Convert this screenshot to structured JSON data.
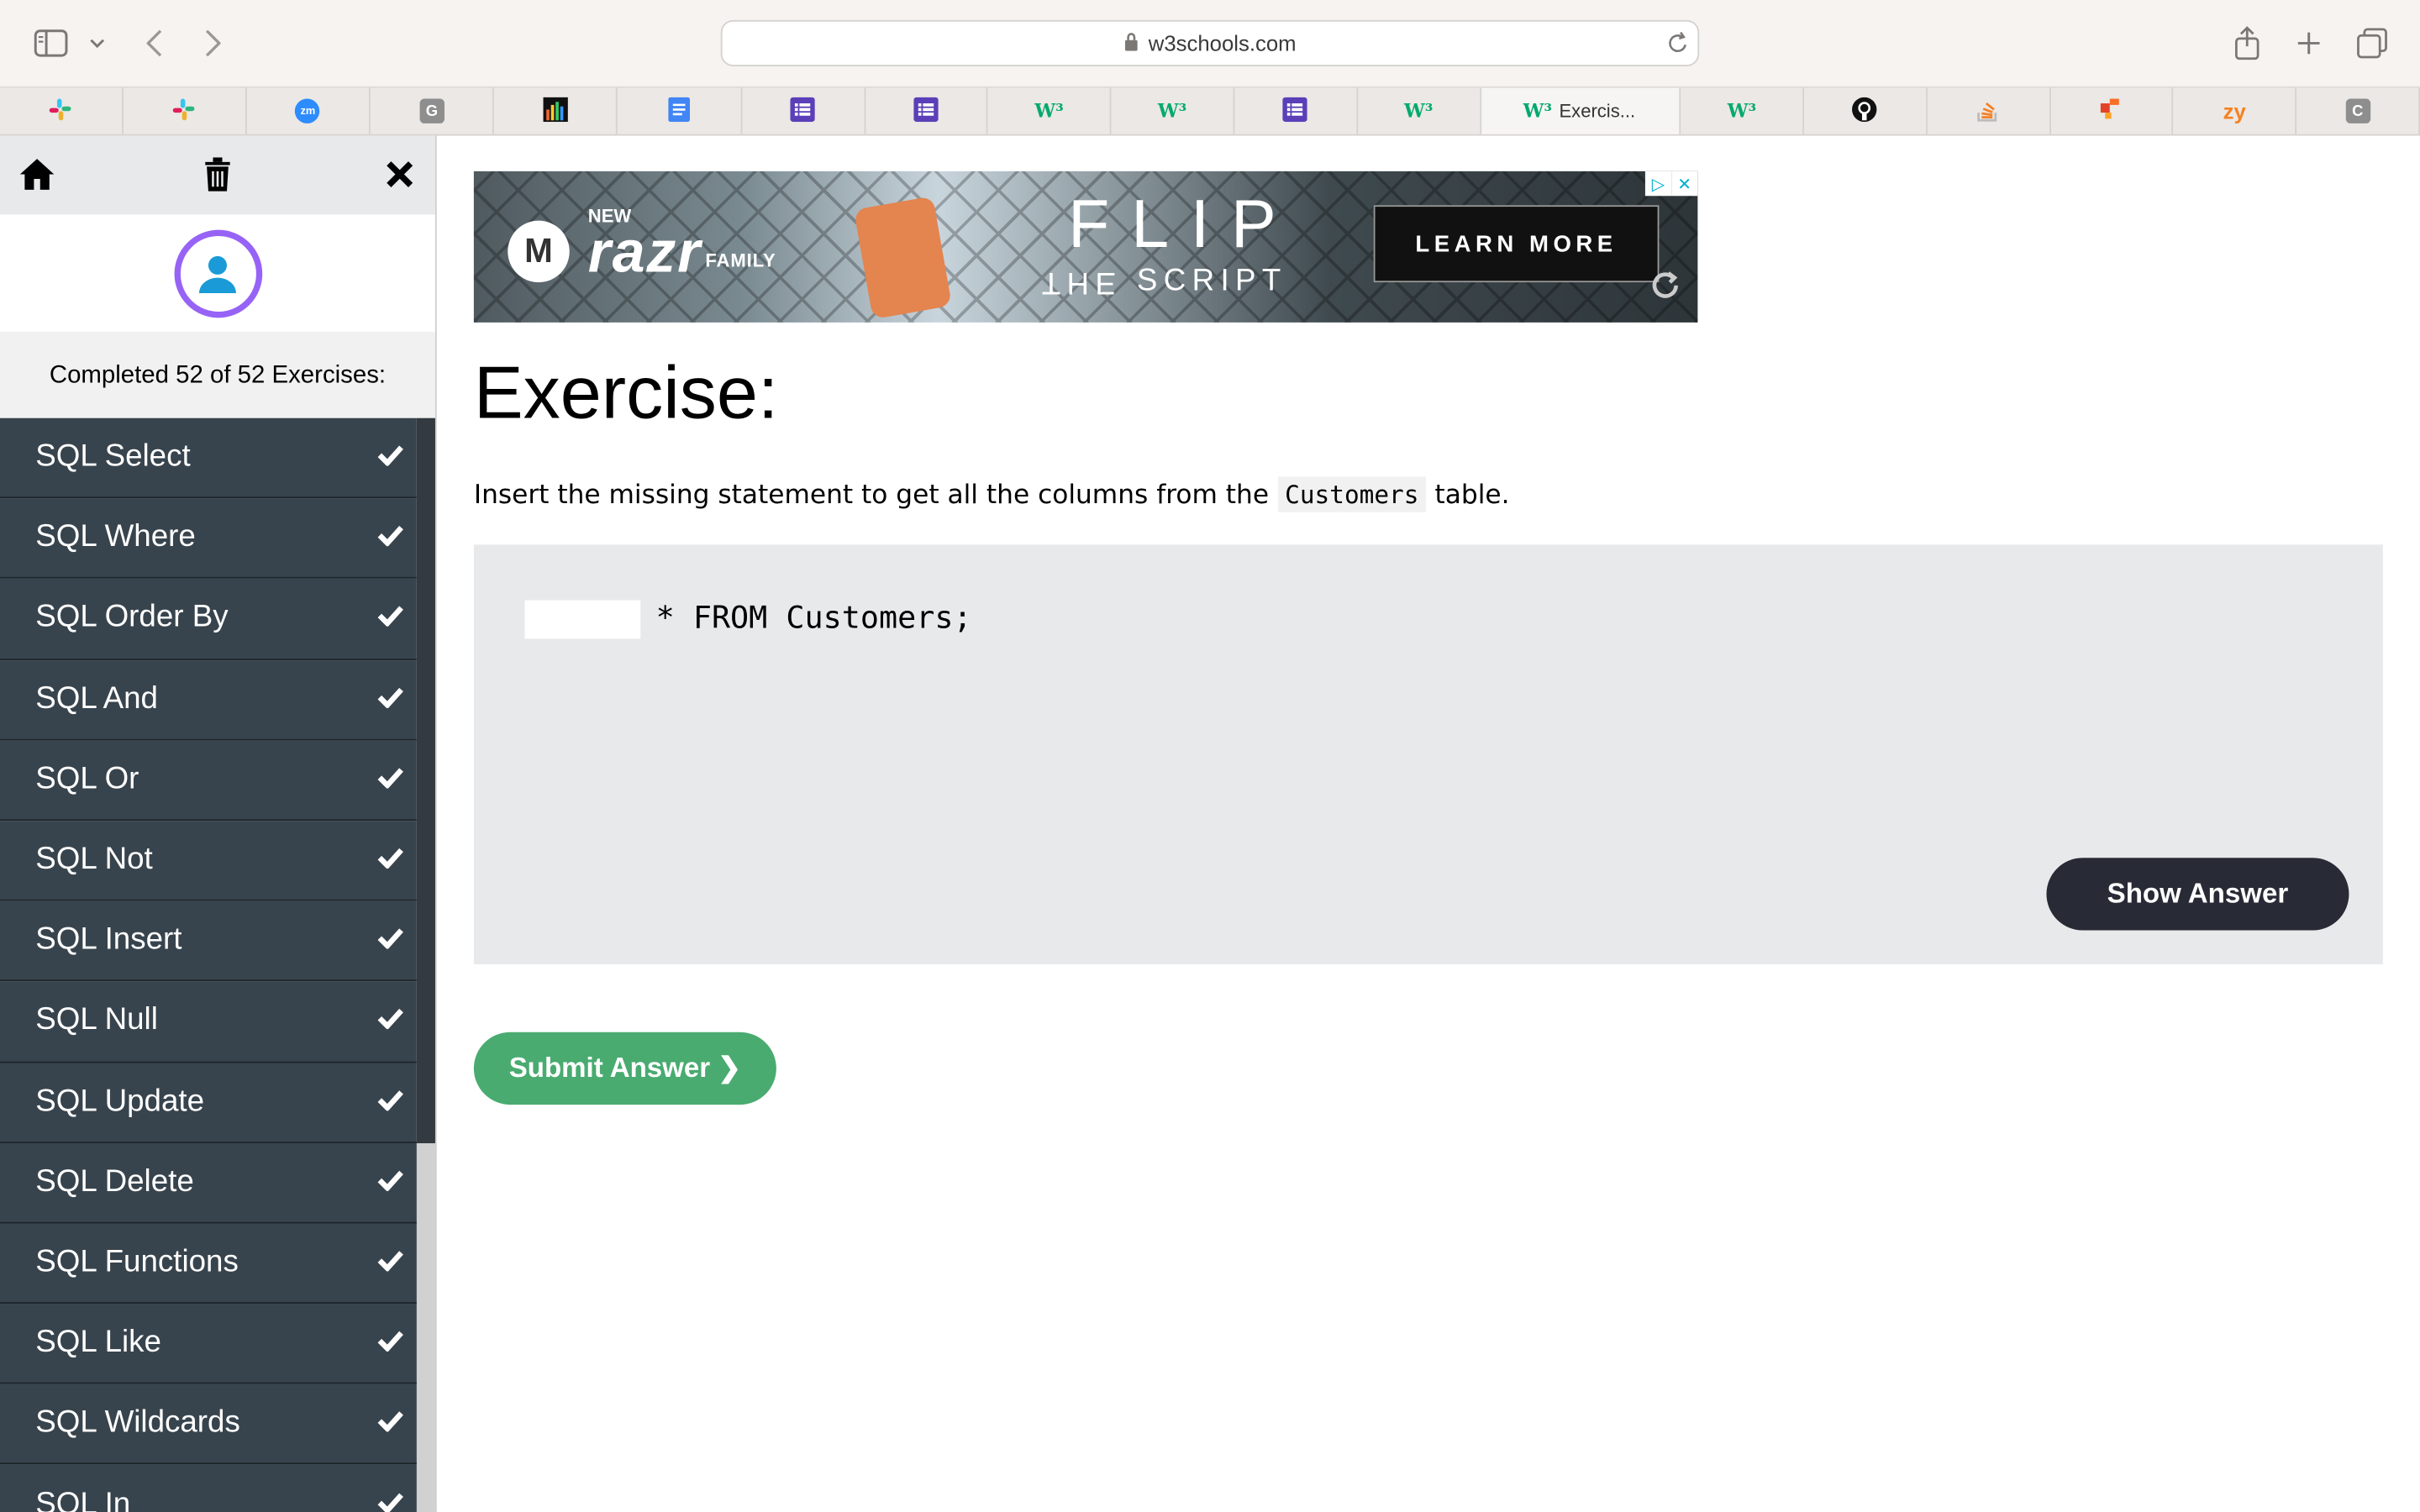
{
  "browser": {
    "url": "w3schools.com",
    "tabs": [
      {
        "icon": "slack-icon",
        "title": ""
      },
      {
        "icon": "slack-icon",
        "title": ""
      },
      {
        "icon": "zoom-icon",
        "title": ""
      },
      {
        "icon": "g-icon",
        "title": ""
      },
      {
        "icon": "bar-chart-icon",
        "title": ""
      },
      {
        "icon": "google-docs-icon",
        "title": ""
      },
      {
        "icon": "list-doc-icon",
        "title": ""
      },
      {
        "icon": "list-doc-icon",
        "title": ""
      },
      {
        "icon": "w3schools-icon",
        "title": ""
      },
      {
        "icon": "w3schools-icon",
        "title": ""
      },
      {
        "icon": "list-doc-icon",
        "title": ""
      },
      {
        "icon": "w3schools-icon",
        "title": ""
      },
      {
        "icon": "w3schools-icon",
        "title": "Exercis..."
      },
      {
        "icon": "w3schools-icon",
        "title": ""
      },
      {
        "icon": "github-icon",
        "title": ""
      },
      {
        "icon": "stackoverflow-icon",
        "title": ""
      },
      {
        "icon": "gitlab-icon",
        "title": ""
      },
      {
        "icon": "zy-icon",
        "title": ""
      },
      {
        "icon": "c-icon",
        "title": ""
      }
    ]
  },
  "sidebar": {
    "progress_text": "Completed 52 of 52 Exercises:",
    "items": [
      {
        "label": "SQL Select",
        "done": true
      },
      {
        "label": "SQL Where",
        "done": true
      },
      {
        "label": "SQL Order By",
        "done": true
      },
      {
        "label": "SQL And",
        "done": true
      },
      {
        "label": "SQL Or",
        "done": true
      },
      {
        "label": "SQL Not",
        "done": true
      },
      {
        "label": "SQL Insert",
        "done": true
      },
      {
        "label": "SQL Null",
        "done": true
      },
      {
        "label": "SQL Update",
        "done": true
      },
      {
        "label": "SQL Delete",
        "done": true
      },
      {
        "label": "SQL Functions",
        "done": true
      },
      {
        "label": "SQL Like",
        "done": true
      },
      {
        "label": "SQL Wildcards",
        "done": true
      },
      {
        "label": "SQL In",
        "done": true
      }
    ]
  },
  "ad": {
    "new": "NEW",
    "brand": "razr",
    "family": "FAMILY",
    "headline": "FLIP",
    "subline_mirrored": "THE",
    "subline": "SCRIPT",
    "cta": "LEARN MORE"
  },
  "exercise": {
    "title": "Exercise:",
    "desc_before": "Insert the missing statement to get all the columns from the ",
    "desc_code": "Customers",
    "desc_after": " table.",
    "input_value": "",
    "code_rest": "* FROM Customers;",
    "show_answer": "Show Answer",
    "submit": "Submit Answer ❯"
  },
  "colors": {
    "sidebar_item_bg": "#38444d",
    "show_button_bg": "#282a35",
    "submit_button_bg": "#49ab70",
    "avatar_ring": "#9763f6"
  }
}
